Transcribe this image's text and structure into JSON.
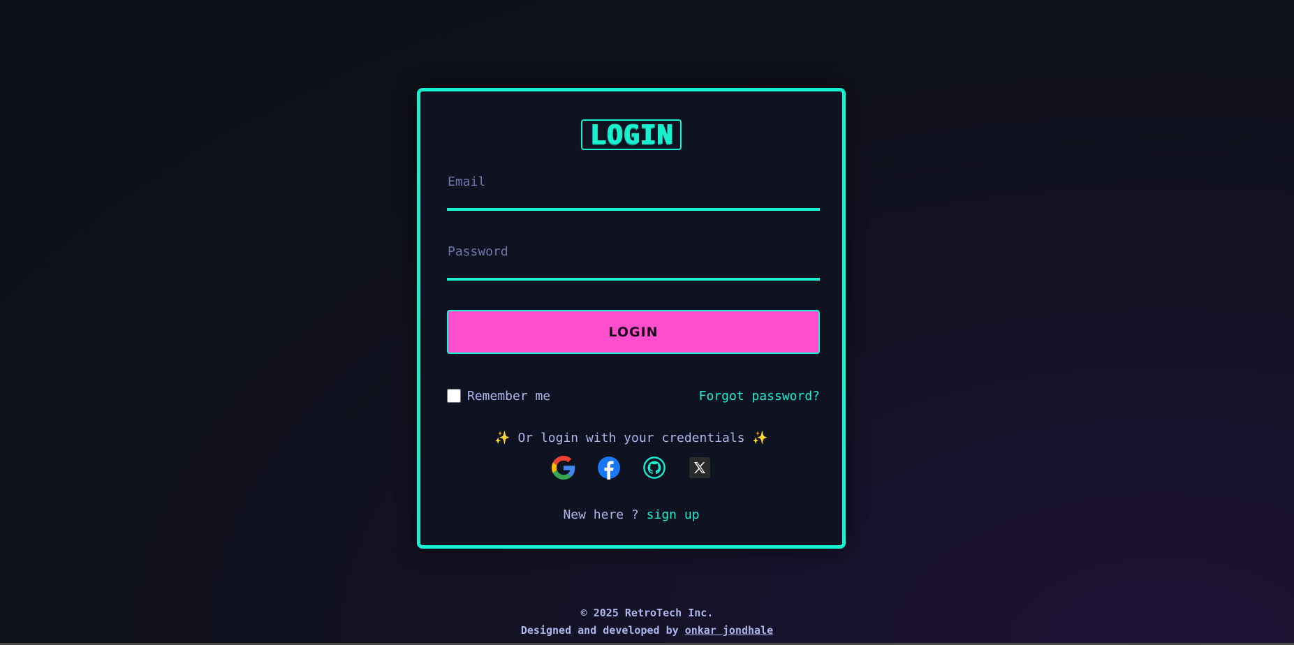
{
  "title": "LOGIN",
  "email": {
    "placeholder": "Email"
  },
  "password": {
    "placeholder": "Password"
  },
  "login_button": "LOGIN",
  "remember_me": "Remember me",
  "forgot_password": "Forgot password?",
  "or_login": "Or login with your credentials",
  "sparkle": "✨",
  "social_icons": [
    "google-icon",
    "facebook-icon",
    "github-icon",
    "x-icon"
  ],
  "new_here": "New here ?",
  "sign_up": "sign up",
  "footer": {
    "copyright": "© 2025 RetroTech Inc.",
    "designed_by": "Designed and developed by",
    "author": "onkar jondhale"
  },
  "colors": {
    "accent": "#18f0d0",
    "button": "#ff4fcf",
    "text": "#aeb5ea",
    "card_bg": "#0f1220"
  }
}
